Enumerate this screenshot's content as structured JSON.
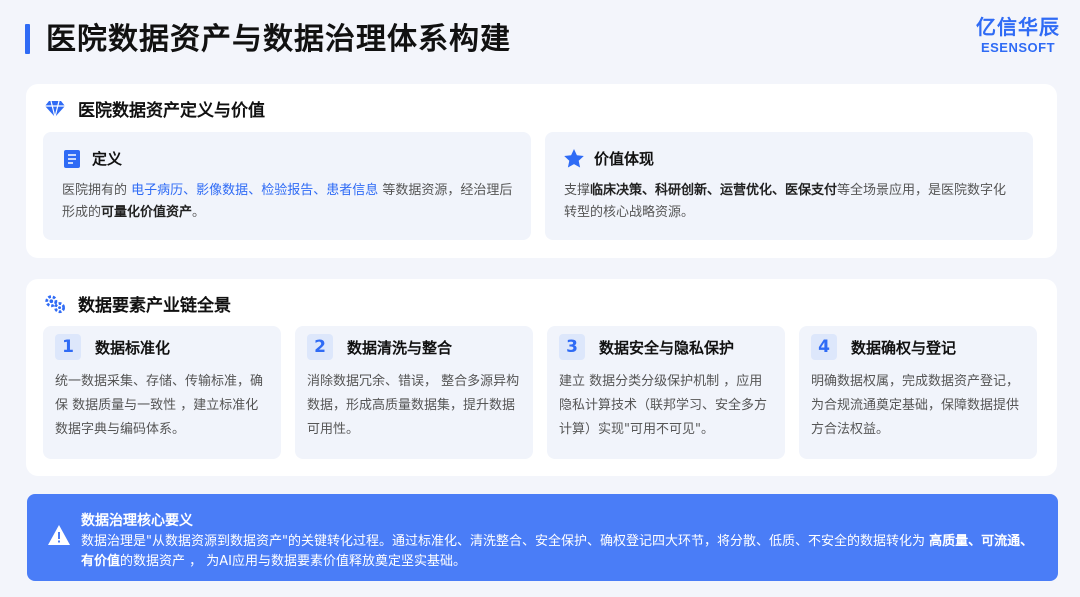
{
  "header": {
    "title": "医院数据资产与数据治理体系构建",
    "brand_cn": "亿信华辰",
    "brand_en": "ESENSOFT"
  },
  "section1": {
    "title": "医院数据资产定义与价值",
    "icon": "diamond-icon",
    "definition": {
      "title": "定义",
      "icon": "document-icon",
      "t1": "医院拥有的 ",
      "l1": "电子病历",
      "s1": "、",
      "l2": "影像数据",
      "s2": "、",
      "l3": "检验报告",
      "s3": "、",
      "l4": "患者信息",
      "t2": " 等数据资源，经治理后形成的",
      "b1": "可量化价值资产",
      "t3": "。"
    },
    "value": {
      "title": "价值体现",
      "icon": "star-icon",
      "t1": "支撑",
      "b1": "临床决策、科研创新、运营优化、医保支付",
      "t2": "等全场景应用，是医院数字化转型的核心战略资源。"
    }
  },
  "section2": {
    "title": "数据要素产业链全景",
    "icon": "gears-icon",
    "cards": [
      {
        "num": "1",
        "title": "数据标准化",
        "body": "统一数据采集、存储、传输标准，确保 数据质量与一致性 ，建立标准化数据字典与编码体系。"
      },
      {
        "num": "2",
        "title": "数据清洗与整合",
        "body": "消除数据冗余、错误， 整合多源异构数据，形成高质量数据集，提升数据可用性。"
      },
      {
        "num": "3",
        "title": "数据安全与隐私保护",
        "body": "建立 数据分类分级保护机制 ，应用隐私计算技术（联邦学习、安全多方计算）实现\"可用不可见\"。"
      },
      {
        "num": "4",
        "title": "数据确权与登记",
        "body": "明确数据权属，完成数据资产登记，为合规流通奠定基础，保障数据提供方合法权益。"
      }
    ]
  },
  "core": {
    "title": "数据治理核心要义",
    "icon": "warning-icon",
    "t1": "数据治理是\"从数据资源到数据资产\"的关键转化过程。通过标准化、清洗整合、安全保护、确权登记四大环节，将分散、低质、不安全的数据转化为 ",
    "b1": "高质量、可流通、有价值",
    "t2": "的数据资产 ， 为AI应用与数据要素价值释放奠定坚实基础。"
  },
  "colors": {
    "accent": "#2f6bf5",
    "core_bg": "#4a7df7",
    "card_bg": "#f1f4fb"
  }
}
